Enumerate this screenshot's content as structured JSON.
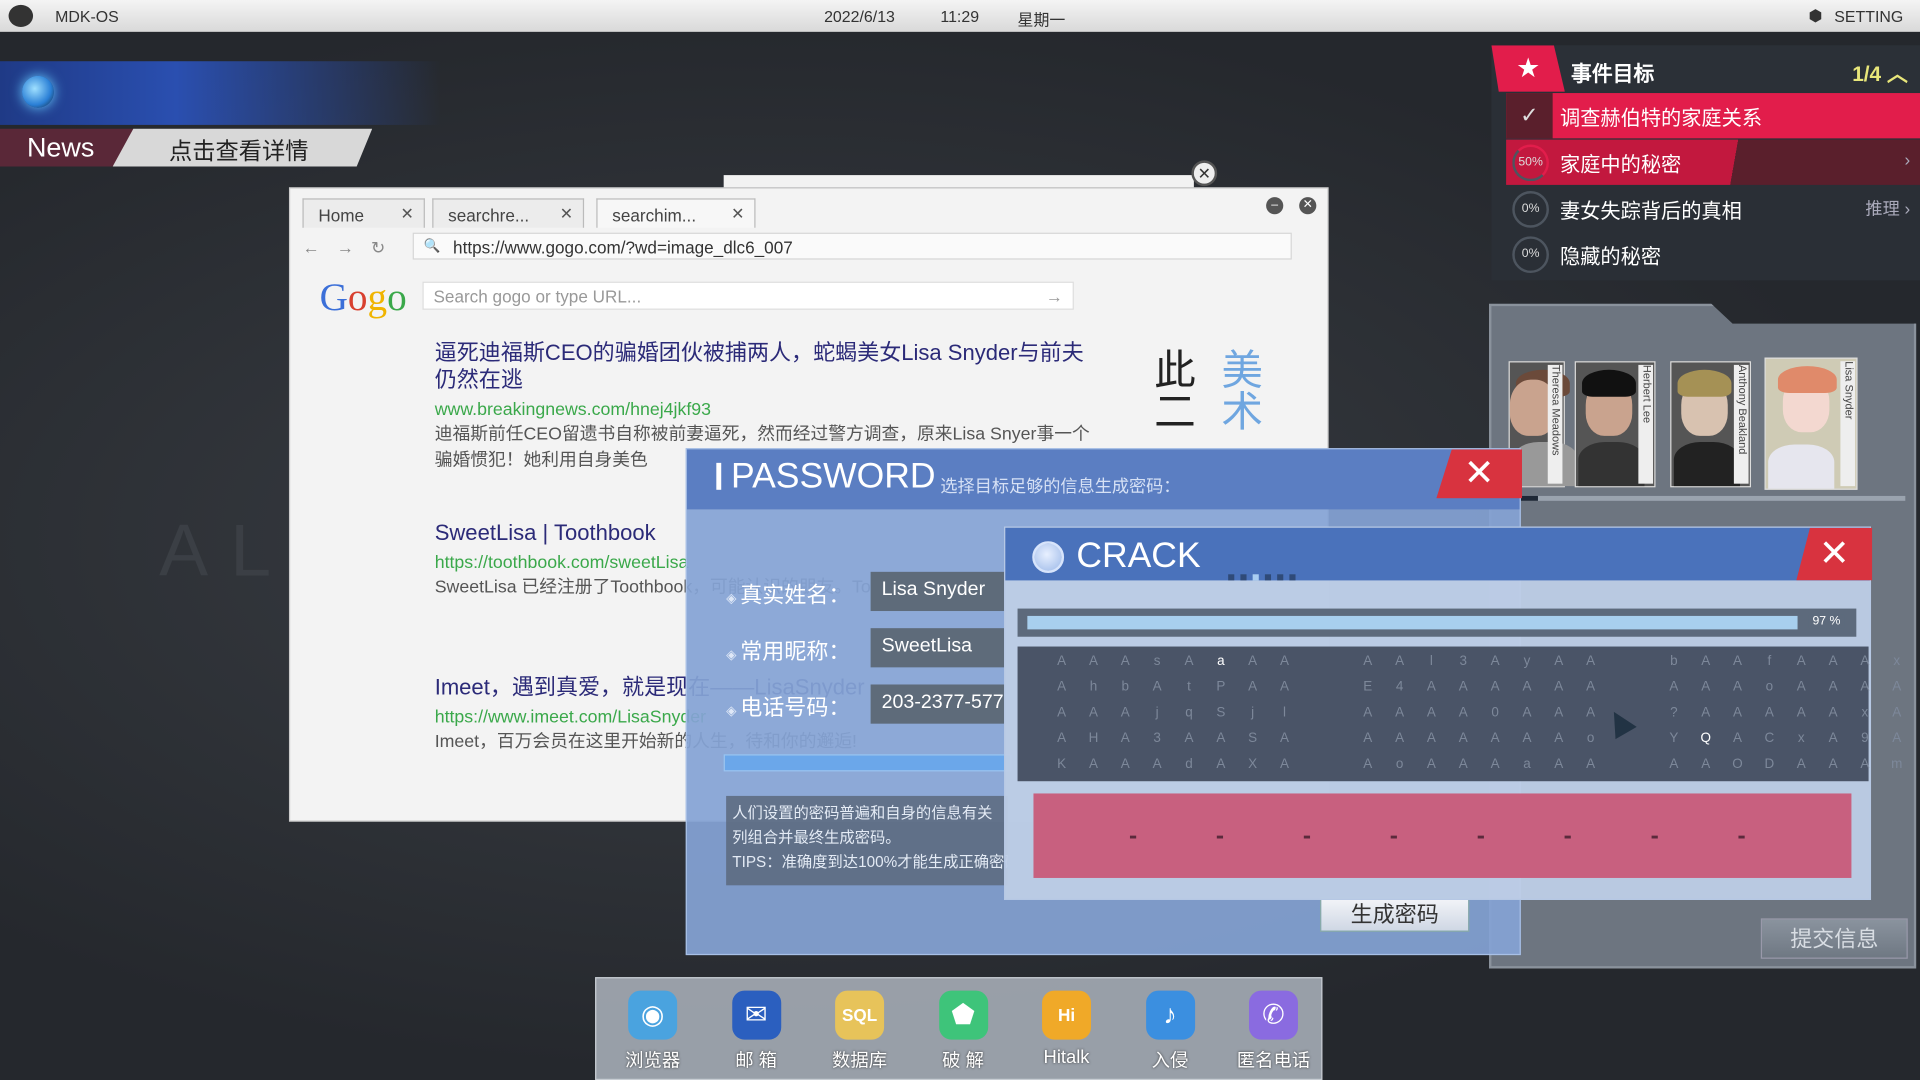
{
  "topbar": {
    "os_name": "MDK-OS",
    "date": "2022/6/13",
    "time": "11:29",
    "weekday": "星期一",
    "setting": "SETTING"
  },
  "background_text": "ALI",
  "news": {
    "label": "News",
    "detail": "点击查看详情"
  },
  "browser": {
    "tabs": [
      {
        "label": "Home"
      },
      {
        "label": "searchre..."
      },
      {
        "label": "searchim..."
      }
    ],
    "url": "https://www.gogo.com/?wd=image_dlc6_007",
    "logo": "Gogo",
    "search_placeholder": "Search gogo or type URL...",
    "results": [
      {
        "title": "逼死迪福斯CEO的骗婚团伙被捕两人，蛇蝎美女Lisa Snyder与前夫仍然在逃",
        "url": "www.breakingnews.com/hnej4jkf93",
        "desc": "迪福斯前任CEO留遗书自称被前妻逼死，然而经过警方调查，原来Lisa Snyer事一个骗婚惯犯！她利用自身美色"
      },
      {
        "title": "SweetLisa | Toothbook",
        "url": "https://toothbook.com/sweetLisa",
        "desc": "SweetLisa 已经注册了Toothbook，可能认识的朋友。Toothbook让人们"
      },
      {
        "title": "Imeet，遇到真爱，就是现在——LisaSnyder",
        "url": "https://www.imeet.com/LisaSnyder",
        "desc": "Imeet，百万会员在这里开始新的人生，待和你的邂逅!"
      }
    ],
    "calligraphy": "此二",
    "calligraphy_blue": "美术"
  },
  "password": {
    "title": "PASSWORD",
    "subtitle": "选择目标足够的信息生成密码：",
    "fields": [
      {
        "label": "真实姓名：",
        "value": "Lisa Snyder"
      },
      {
        "label": "常用昵称：",
        "value": "SweetLisa"
      },
      {
        "label": "电话号码：",
        "value": "203-2377-577"
      }
    ],
    "tips": [
      "人们设置的密码普遍和自身的信息有关",
      "列组合并最终生成密码。",
      "TIPS：准确度到达100%才能生成正确密码"
    ],
    "generate_button": "生成密码"
  },
  "crack": {
    "title": "CRACK",
    "progress_percent": 97,
    "progress_label": "97 %",
    "grid": [
      "AAAsAaAA AAl3AyAA bAAfAAAx",
      "AhbAtPAA E4AAAAAA AAAoAAAA",
      "AAAjqSjl AAAA0AAA ?AAAAAxA",
      "AHA3AASA AAAAAAAo YQACxA9A",
      "KAAAdAXA AoAAAaAA AAODAAAm"
    ],
    "highlighted": [
      [
        0,
        5
      ],
      [
        3,
        17
      ]
    ],
    "password_slots": [
      "-",
      "-",
      "-",
      "-",
      "-",
      "-",
      "-",
      "-"
    ]
  },
  "objectives": {
    "title": "事件目标",
    "count": "1/4",
    "items": [
      {
        "status": "✓",
        "label": "调查赫伯特的家庭关系",
        "state": "done"
      },
      {
        "status": "50%",
        "label": "家庭中的秘密",
        "state": "active",
        "progress": 50
      },
      {
        "status": "0%",
        "label": "妻女失踪背后的真相",
        "action": "推理",
        "progress": 0
      },
      {
        "status": "0%",
        "label": "隐藏的秘密",
        "progress": 0
      }
    ]
  },
  "profiles": {
    "cards": [
      {
        "name": "Theresa Meadows"
      },
      {
        "name": "Herbert Lee"
      },
      {
        "name": "Anthony Beakland"
      },
      {
        "name": "Lisa Snyder"
      }
    ],
    "submit_button": "提交信息"
  },
  "dock": [
    {
      "label": "浏览器",
      "icon": "browser-icon",
      "color": "#4aa3df"
    },
    {
      "label": "邮 箱",
      "icon": "mail-icon",
      "color": "#2b5fbf"
    },
    {
      "label": "数据库",
      "icon": "database-icon",
      "color": "#e7c35a"
    },
    {
      "label": "破 解",
      "icon": "crack-icon",
      "color": "#3ec47a"
    },
    {
      "label": "Hitalk",
      "icon": "hitalk-icon",
      "color": "#f0a928"
    },
    {
      "label": "入侵",
      "icon": "intrude-icon",
      "color": "#3b8fe0"
    },
    {
      "label": "匿名电话",
      "icon": "phone-icon",
      "color": "#8a6be0"
    }
  ],
  "colors": {
    "accent_red": "#e21d4b",
    "panel_blue": "#5b7ec2",
    "crack_pink": "#c8607f"
  }
}
